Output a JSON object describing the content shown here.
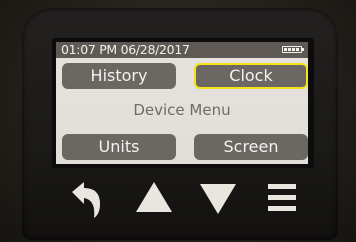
{
  "status_bar": {
    "datetime": "01:07 PM 06/28/2017",
    "battery_icon": "battery-full-icon",
    "battery_level": 1.0
  },
  "menu": {
    "title": "Device Menu",
    "buttons": {
      "history": "History",
      "clock": "Clock",
      "units": "Units",
      "screen": "Screen"
    },
    "selected": "Clock"
  },
  "hardware_keys": {
    "back_icon": "back-arrow-icon",
    "up_icon": "triangle-up-icon",
    "down_icon": "triangle-down-icon",
    "menu_icon": "hamburger-menu-icon"
  },
  "colors": {
    "screen_bg": "#e3e0db",
    "button_bg": "#6b6762",
    "selected_border": "#f3e21c",
    "key_icon": "#e9e6e0"
  }
}
